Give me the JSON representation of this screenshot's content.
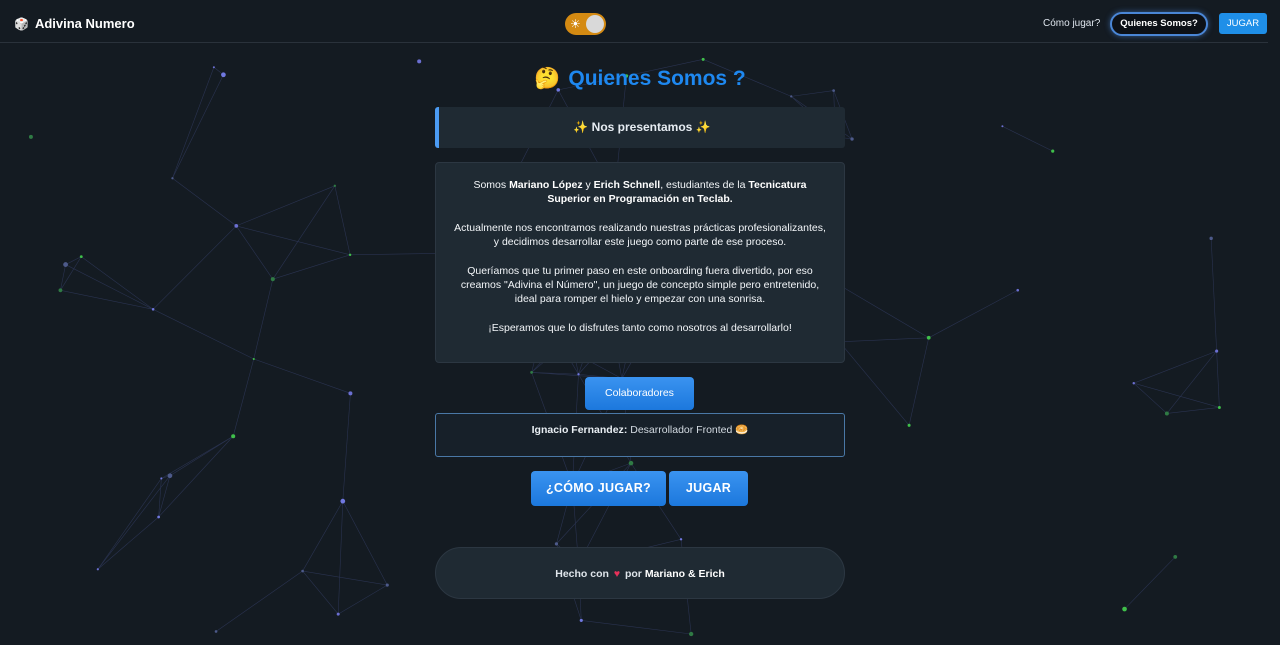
{
  "navbar": {
    "brand_icon": "🎲",
    "brand": "Adivina Numero",
    "theme_icon": "☀",
    "links": {
      "how": "Cómo jugar?",
      "about": "Quienes Somos?",
      "play": "JUGAR"
    }
  },
  "main": {
    "title_icon": "🤔",
    "title": "Quienes Somos ?",
    "banner": "✨ Nos presentamos ✨",
    "about": {
      "p1_a": "Somos ",
      "p1_name1": "Mariano López",
      "p1_b": " y ",
      "p1_name2": "Erich Schnell",
      "p1_c": ", estudiantes de la ",
      "p1_school": "Tecnicatura Superior en Programación en Teclab.",
      "p2": "Actualmente nos encontramos realizando nuestras prácticas profesionalizantes, y decidimos desarrollar este juego como parte de ese proceso.",
      "p3": "Queríamos que tu primer paso en este onboarding fuera divertido, por eso creamos \"Adivina el Número\", un juego de concepto simple pero entretenido, ideal para romper el hielo y empezar con una sonrisa.",
      "p4": "¡Esperamos que lo disfrutes tanto como nosotros al desarrollarlo!"
    },
    "collaborators_button": "Colaboradores",
    "collaborator": {
      "name": "Ignacio Fernandez",
      "separator": ":",
      "role": " Desarrollador Fronted",
      "emoji": "🥯"
    },
    "how_button": "¿CÓMO JUGAR?",
    "play_button": "JUGAR"
  },
  "footer": {
    "prefix": "Hecho con ",
    "heart": "♥",
    "middle": " por ",
    "authors": "Mariano & Erich"
  },
  "colors": {
    "background": "#141b22",
    "accent": "#1e88f0",
    "card": "#1f2a33",
    "toggle": "#d48a12",
    "heart": "#e8315a"
  }
}
